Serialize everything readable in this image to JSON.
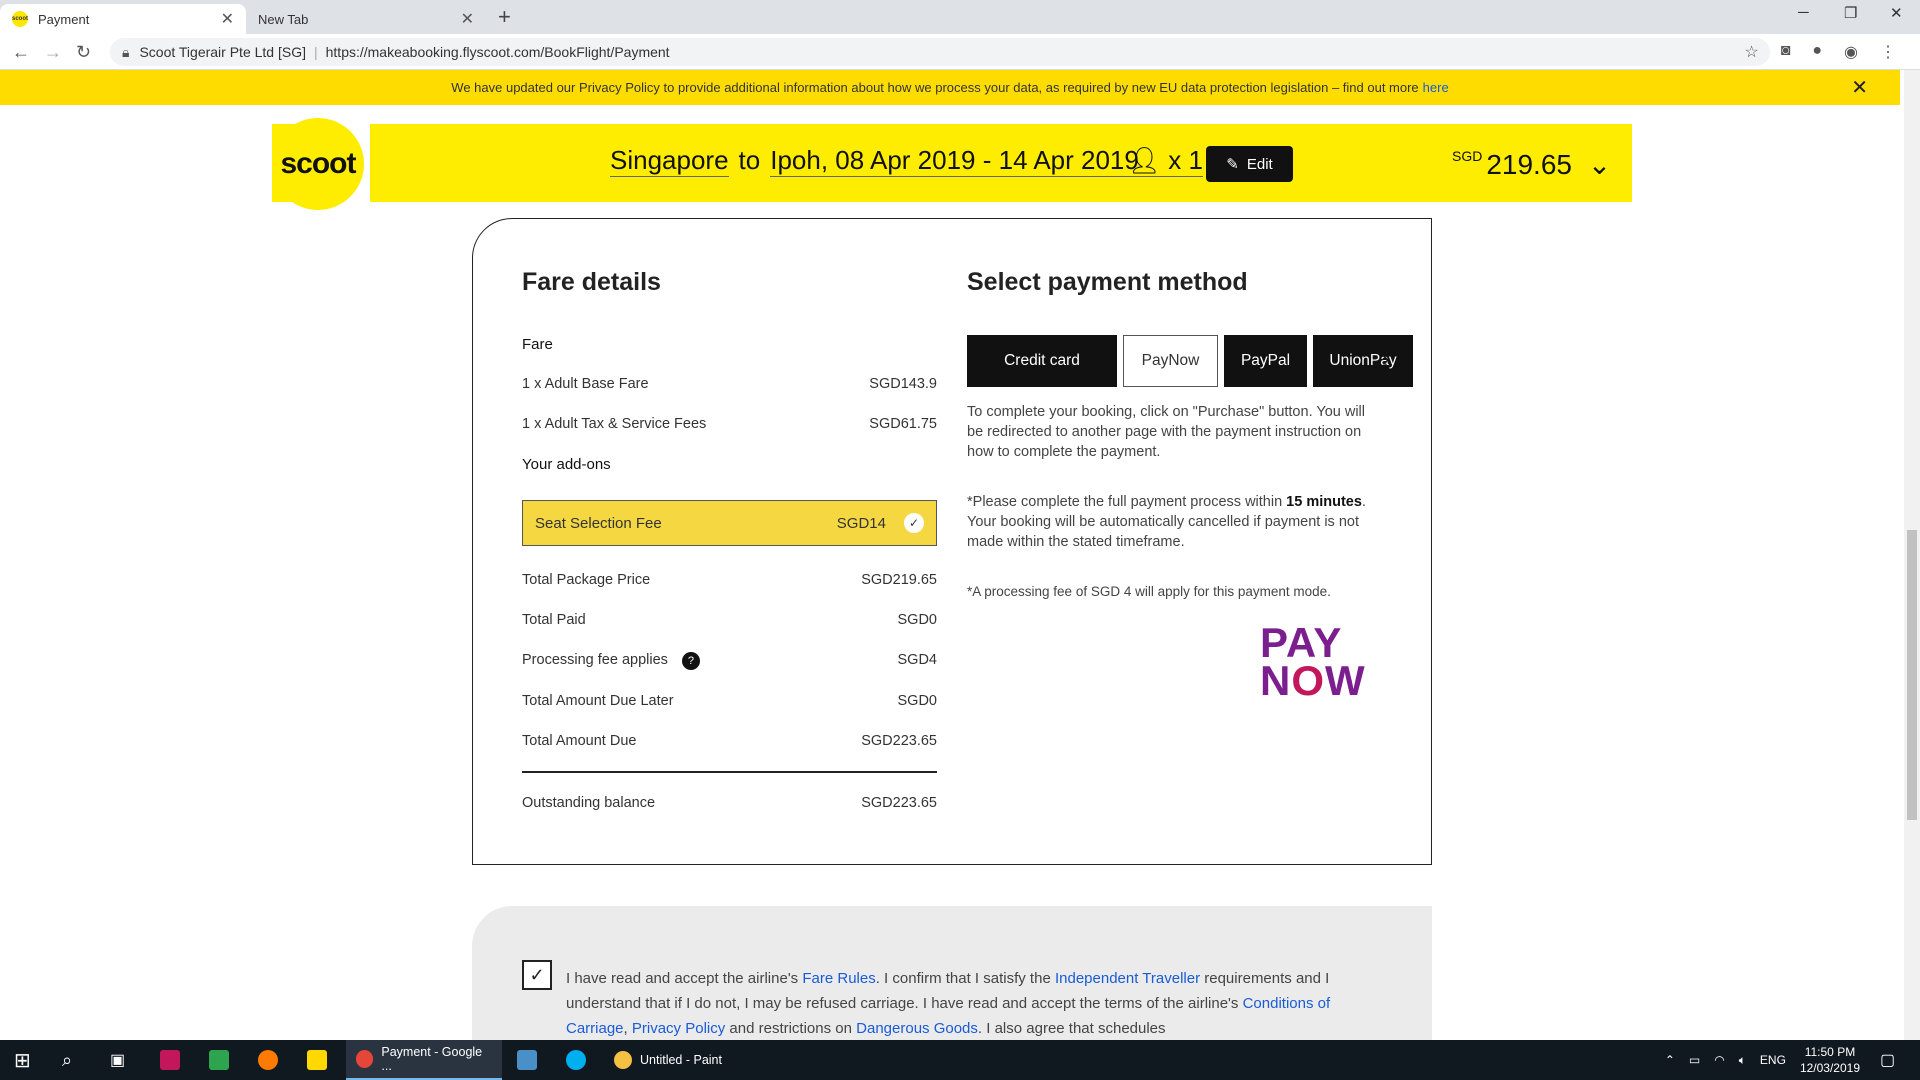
{
  "browser": {
    "tabs": [
      {
        "label": "Payment",
        "active": true
      },
      {
        "label": "New Tab",
        "active": false
      }
    ],
    "new_tab_symbol": "+",
    "address": {
      "org": "Scoot Tigerair Pte Ltd [SG]",
      "url": "https://makeabooking.flyscoot.com/BookFlight/Payment"
    }
  },
  "banner": {
    "text": "We have updated our Privacy Policy to provide additional information about how we process your data, as required by new EU data protection legislation – find out more",
    "link": "here"
  },
  "header": {
    "logo": "scoot",
    "origin": "Singapore",
    "to": "to",
    "destination": "Ipoh, 08 Apr 2019 - 14 Apr 2019",
    "pax": "x 1",
    "edit_label": "Edit",
    "currency": "SGD",
    "price": "219.65"
  },
  "fare": {
    "title": "Fare details",
    "fare_label": "Fare",
    "rows": [
      {
        "label": "1 x Adult Base Fare",
        "value": "SGD143.9"
      },
      {
        "label": "1 x Adult Tax & Service Fees",
        "value": "SGD61.75"
      }
    ],
    "addons_label": "Your add-ons",
    "addon": {
      "label": "Seat Selection Fee",
      "value": "SGD14"
    },
    "totals": [
      {
        "label": "Total Package Price",
        "value": "SGD219.65"
      },
      {
        "label": "Total Paid",
        "value": "SGD0"
      },
      {
        "label": "Processing fee applies",
        "value": "SGD4"
      },
      {
        "label": "Total Amount Due Later",
        "value": "SGD0"
      },
      {
        "label": "Total Amount Due",
        "value": "SGD223.65"
      }
    ],
    "outstanding": {
      "label": "Outstanding balance",
      "value": "SGD223.65"
    }
  },
  "payment": {
    "title": "Select payment method",
    "tabs": [
      {
        "label": "Credit card",
        "selected": false
      },
      {
        "label": "PayNow",
        "selected": true
      },
      {
        "label": "PayPal",
        "selected": false
      },
      {
        "label": "UnionPay",
        "selected": false
      }
    ],
    "instructions": "To complete your booking, click on \"Purchase\" button. You will be redirected to another page with the payment instruction on how to complete the payment.",
    "timing_pre": "*Please complete the full payment process within",
    "timing_bold": "15 minutes",
    "timing_post": ". Your booking will be automatically cancelled if payment is not made within the stated timeframe.",
    "fee_note": "*A processing fee of SGD 4 will apply for this payment mode.",
    "logo_top": "PAY",
    "logo_bottom_n": "N",
    "logo_bottom_o": "O",
    "logo_bottom_w": "W"
  },
  "terms": {
    "t1": "I have read and accept the airline's",
    "l1": "Fare Rules",
    "t2": ". I confirm that I satisfy the",
    "l2": "Independent Traveller",
    "t3": "requirements and I understand that if I do not, I may be refused carriage. I have read and accept the terms of the airline's",
    "l3": "Conditions of Carriage",
    "t4": ",",
    "l4": "Privacy Policy",
    "t5": "and restrictions on",
    "l5": "Dangerous Goods",
    "t6": ". I also agree that schedules"
  },
  "taskbar": {
    "windows": [
      {
        "label": "Payment - Google ...",
        "active": true
      },
      {
        "label": "Untitled - Paint",
        "active": false
      }
    ],
    "lang": "ENG",
    "time": "11:50 PM",
    "date": "12/03/2019"
  },
  "colors": {
    "brand_yellow": "#ffed00",
    "banner_yellow": "#ffdc00",
    "link_blue": "#1a5bd6",
    "paynow_purple": "#7b1f8f"
  }
}
